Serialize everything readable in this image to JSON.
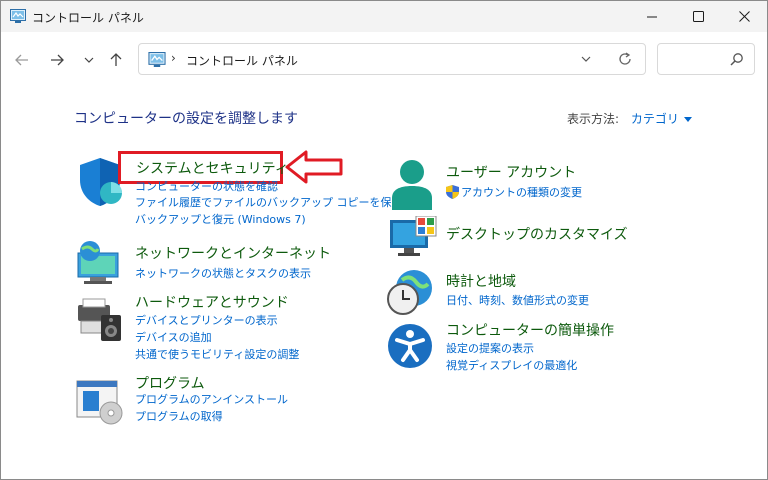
{
  "window": {
    "title": "コントロール パネル"
  },
  "address": {
    "path": "コントロール パネル"
  },
  "header": {
    "heading": "コンピューターの設定を調整します",
    "view_by_label": "表示方法:",
    "view_by_value": "カテゴリ"
  },
  "categories": {
    "system": {
      "title": "システムとセキュリティ",
      "links": [
        "コンピューターの状態を確認",
        "ファイル履歴でファイルのバックアップ コピーを保存",
        "バックアップと復元 (Windows 7)"
      ]
    },
    "network": {
      "title": "ネットワークとインターネット",
      "links": [
        "ネットワークの状態とタスクの表示"
      ]
    },
    "hardware": {
      "title": "ハードウェアとサウンド",
      "links": [
        "デバイスとプリンターの表示",
        "デバイスの追加",
        "共通で使うモビリティ設定の調整"
      ]
    },
    "programs": {
      "title": "プログラム",
      "links": [
        "プログラムのアンインストール",
        "プログラムの取得"
      ]
    },
    "user": {
      "title": "ユーザー アカウント",
      "links": [
        "アカウントの種類の変更"
      ]
    },
    "desktop": {
      "title": "デスクトップのカスタマイズ"
    },
    "clock": {
      "title": "時計と地域",
      "links": [
        "日付、時刻、数値形式の変更"
      ]
    },
    "ease": {
      "title": "コンピューターの簡単操作",
      "links": [
        "設定の提案の表示",
        "視覚ディスプレイの最適化"
      ]
    }
  },
  "colors": {
    "accent": "#0066cc",
    "category_title": "#0d5a0d",
    "callout": "#e01b24"
  },
  "icons": [
    "control-panel-icon",
    "back-icon",
    "forward-icon",
    "recent-dropdown-icon",
    "up-icon",
    "refresh-icon",
    "search-icon",
    "minimize-icon",
    "maximize-icon",
    "close-icon"
  ]
}
